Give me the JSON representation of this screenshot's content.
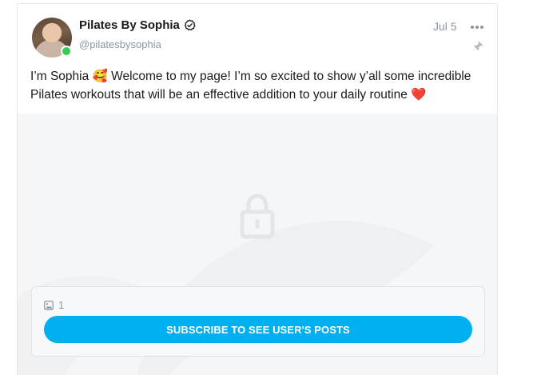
{
  "post": {
    "author_name": "Pilates By Sophia",
    "author_handle": "@pilatesbysophia",
    "date": "Jul 5",
    "text_before_emoji": "I’m Sophia ",
    "emoji_1": "🥰",
    "text_middle": " Welcome to my page! I’m so excited to show y’all some incredible Pilates workouts that will be an effective addition to your daily routine ",
    "emoji_2": "❤️",
    "media_count": "1",
    "subscribe_label": "SUBSCRIBE TO SEE USER'S POSTS"
  },
  "icons": {
    "verified": "verified-check-icon",
    "more": "more-dots-icon",
    "pin": "pin-icon",
    "lock": "lock-icon",
    "image": "image-icon"
  },
  "colors": {
    "accent": "#00aff0",
    "online": "#33cc55",
    "muted_text": "#8a96a3",
    "locked_bg": "#f5f6f7"
  }
}
